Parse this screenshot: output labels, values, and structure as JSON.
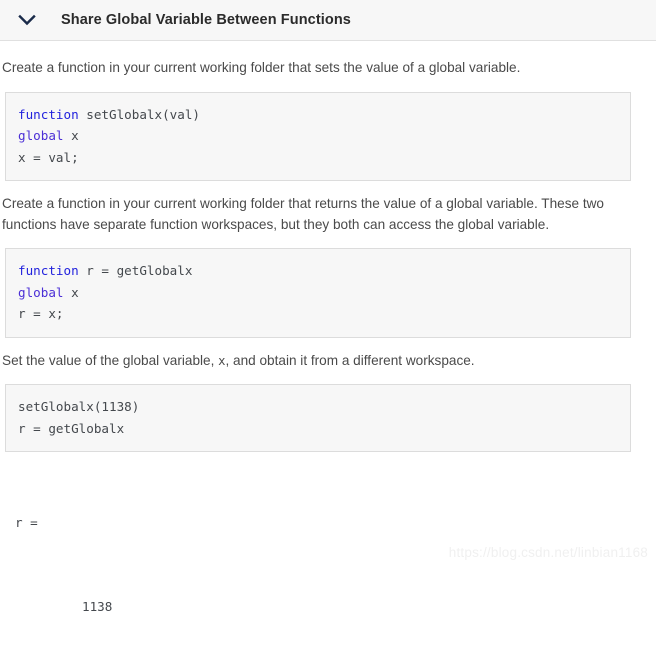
{
  "header": {
    "title": "Share Global Variable Between Functions",
    "chevron_icon": "chevron-down-icon",
    "background_color": "#f7f7f7",
    "border_color": "#e0e0e0",
    "title_color": "#2b2b2b",
    "chevron_color": "#1a2b4a"
  },
  "paragraphs": {
    "p1": "Create a function in your current working folder that sets the value of a global variable.",
    "p2": "Create a function in your current working folder that returns the value of a global variable. These two functions have separate function workspaces, but they both can access the global variable.",
    "p3_part1": "Set the value of the global variable, ",
    "p3_code": "x",
    "p3_part2": ", and obtain it from a different workspace."
  },
  "code_blocks": {
    "block1": {
      "line1_kw": "function",
      "line1_rest": " setGlobalx(val)",
      "line2_kw": "global",
      "line2_rest": " x",
      "line3": "x = val;"
    },
    "block2": {
      "line1_kw": "function",
      "line1_rest": " r = getGlobalx",
      "line2_kw": "global",
      "line2_rest": " x",
      "line3": "r = x;"
    },
    "block3": {
      "line1": "setGlobalx(1138)",
      "line2": "r = getGlobalx"
    }
  },
  "output": {
    "label": "r =",
    "value": "1138"
  },
  "watermark": {
    "text": "https://blog.csdn.net/linbian1168",
    "color": "#f0f0f0"
  },
  "colors": {
    "keyword_blue": "#2222dd",
    "keyword_purple": "#4b2fd6",
    "code_text": "#44484d",
    "body_text": "#4a4a4a",
    "code_bg": "#f7f7f7",
    "code_border": "#dcdcdc"
  }
}
